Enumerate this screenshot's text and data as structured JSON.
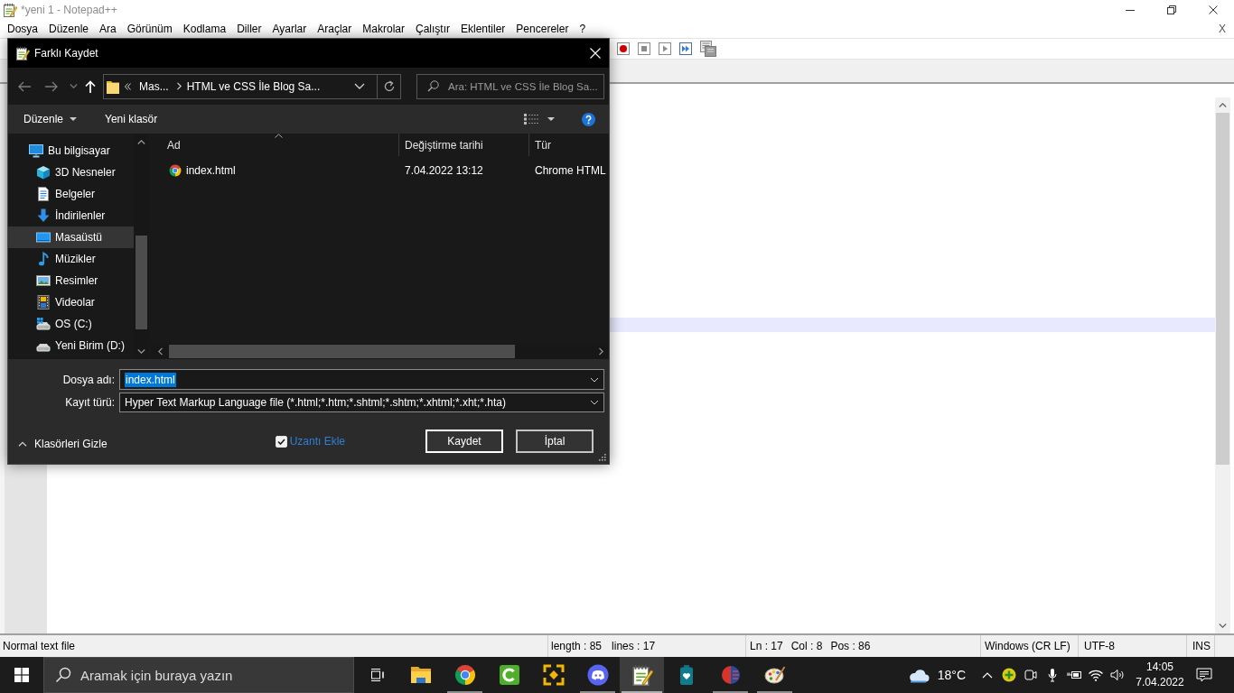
{
  "window": {
    "title": "*yeni 1 - Notepad++"
  },
  "menu_bar": {
    "items": [
      "Dosya",
      "Düzenle",
      "Ara",
      "Görünüm",
      "Kodlama",
      "Diller",
      "Ayarlar",
      "Araçlar",
      "Makrolar",
      "Çalıştır",
      "Eklentiler",
      "Pencereler",
      "?"
    ],
    "close_document": "X"
  },
  "editor": {
    "current_line_highlighted": true
  },
  "status_bar": {
    "file_type": "Normal text file",
    "length": "length : 85",
    "lines": "lines : 17",
    "line": "Ln : 17",
    "column": "Col : 8",
    "position": "Pos : 86",
    "line_endings": "Windows (CR LF)",
    "encoding": "UTF-8",
    "mode": "INS"
  },
  "dialog": {
    "title": "Farklı Kaydet",
    "navigation": {
      "back": {
        "disabled": true
      },
      "forward": {
        "disabled": true
      },
      "up": {
        "disabled": false
      }
    },
    "address_bar": {
      "crumbs": [
        "Mas...",
        "HTML ve CSS İle Blog Sa..."
      ]
    },
    "search": {
      "placeholder": "Ara: HTML ve CSS İle Blog Sa..."
    },
    "command_bar": {
      "organize": "Düzenle",
      "new_folder": "Yeni klasör"
    },
    "nav_pane": [
      {
        "label": "Bu bilgisayar",
        "kind": "computer",
        "selected": false,
        "children": [
          {
            "label": "3D Nesneler",
            "kind": "cube",
            "selected": false
          },
          {
            "label": "Belgeler",
            "kind": "documents",
            "selected": false
          },
          {
            "label": "İndirilenler",
            "kind": "downloads",
            "selected": false
          },
          {
            "label": "Masaüstü",
            "kind": "desktop",
            "selected": true
          },
          {
            "label": "Müzikler",
            "kind": "music",
            "selected": false
          },
          {
            "label": "Resimler",
            "kind": "pictures",
            "selected": false
          },
          {
            "label": "Videolar",
            "kind": "videos",
            "selected": false
          },
          {
            "label": "OS (C:)",
            "kind": "system-drive",
            "selected": false
          },
          {
            "label": "Yeni Birim (D:)",
            "kind": "drive",
            "selected": false
          }
        ]
      }
    ],
    "file_list": {
      "columns": [
        {
          "label": "Ad",
          "sorted": true
        },
        {
          "label": "Değiştirme tarihi",
          "sorted": false
        },
        {
          "label": "Tür",
          "sorted": false
        }
      ],
      "rows": [
        {
          "cells": [
            "index.html",
            "7.04.2022 13:12",
            "Chrome HTML"
          ],
          "selected": false
        }
      ]
    },
    "file_name": {
      "label": "Dosya adı:",
      "value": "index.html",
      "text_selected": true
    },
    "file_type": {
      "label": "Kayıt türü:",
      "value": "Hyper Text Markup Language file (*.html;*.htm;*.shtml;*.shtm;*.xhtml;*.xht;*.hta)"
    },
    "hide_folders": "Klasörleri Gizle",
    "add_extension": {
      "label": "Uzantı Ekle",
      "checked": true
    },
    "buttons": [
      {
        "label": "Kaydet",
        "default": true
      },
      {
        "label": "İptal",
        "default": false
      }
    ]
  },
  "taskbar": {
    "search_placeholder": "Aramak için buraya yazın",
    "apps": [
      {
        "kind": "folder",
        "running": false,
        "active": false
      },
      {
        "kind": "browser",
        "running": true,
        "active": false
      },
      {
        "kind": "c-tile",
        "running": false,
        "active": false
      },
      {
        "kind": "network",
        "running": false,
        "active": false
      },
      {
        "kind": "chat",
        "running": true,
        "active": false
      },
      {
        "kind": "notepad",
        "running": true,
        "active": true
      },
      {
        "kind": "battery",
        "running": false,
        "active": false
      },
      {
        "kind": "split-head",
        "running": true,
        "active": false
      },
      {
        "kind": "palette",
        "running": true,
        "active": false
      }
    ],
    "weather": "18°C",
    "time": "14:05",
    "date": "7.04.2022"
  }
}
